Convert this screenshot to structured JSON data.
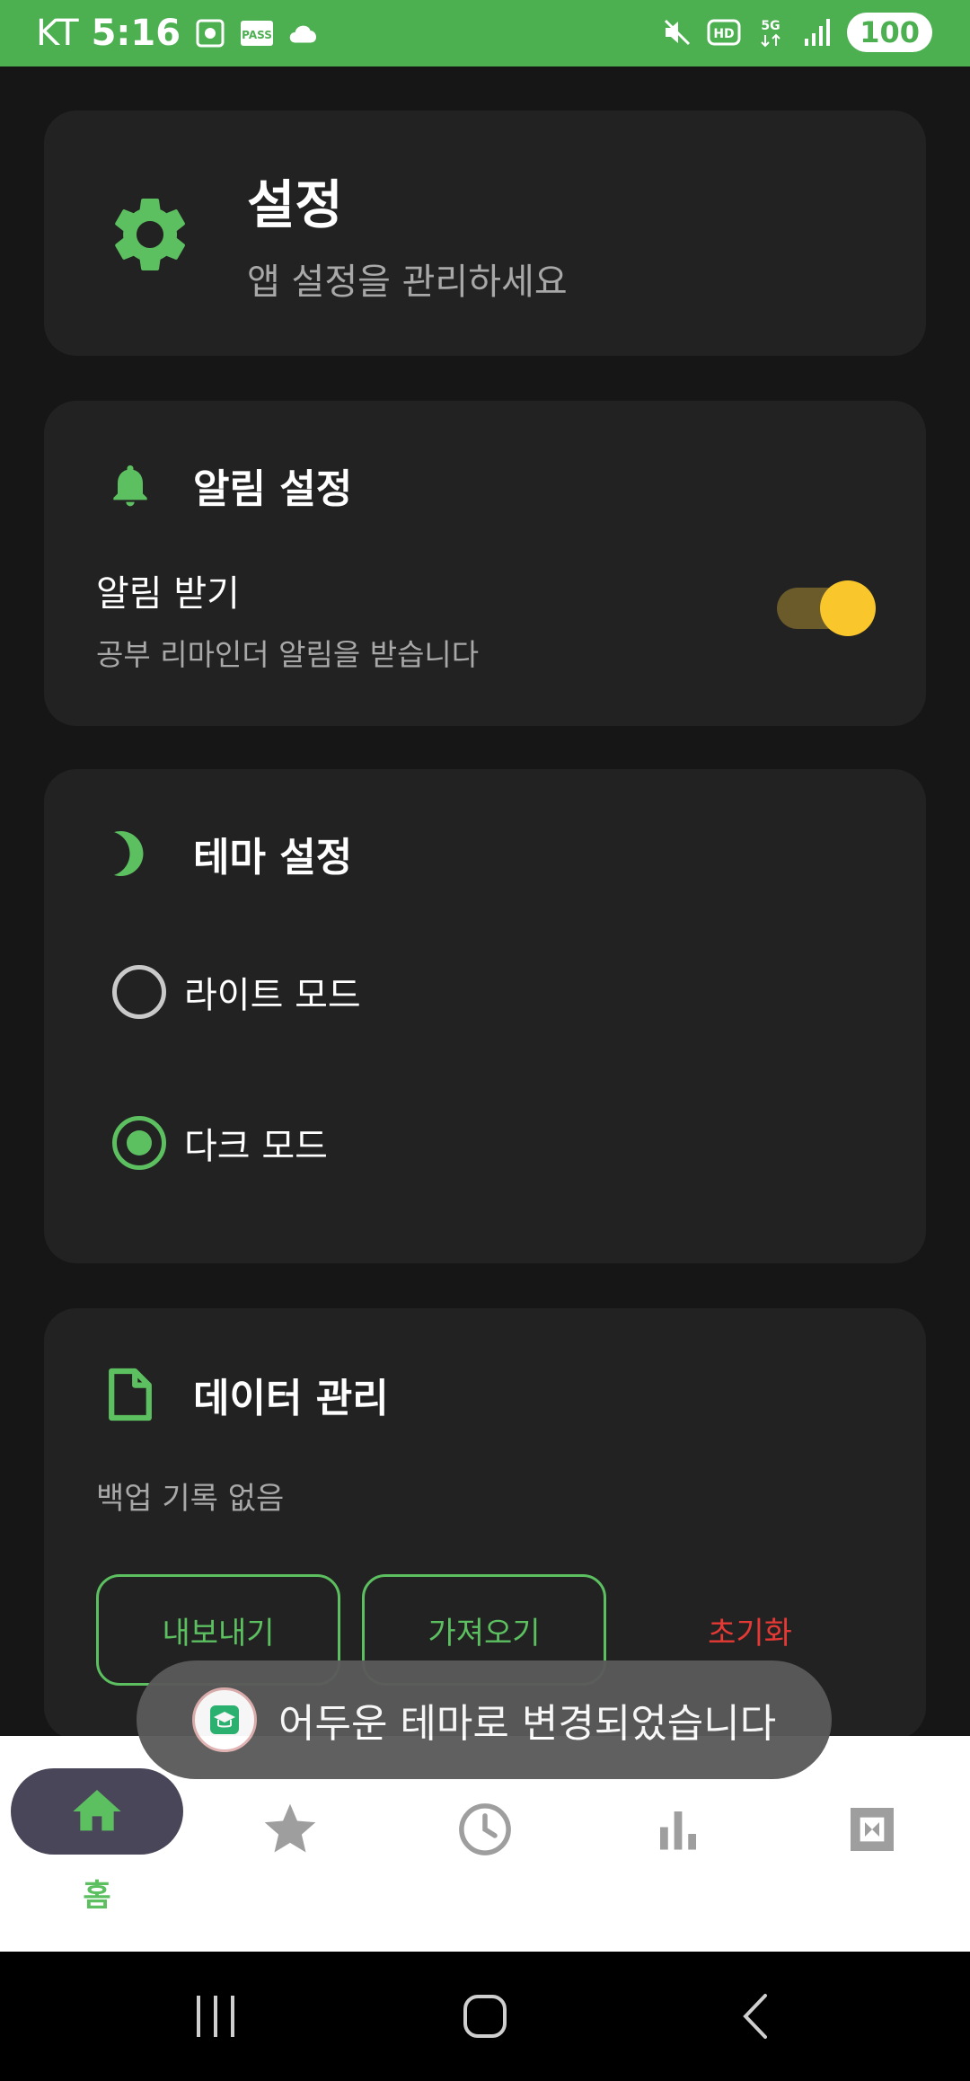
{
  "statusbar": {
    "carrier": "KT",
    "time": "5:16",
    "battery": "100",
    "icons": [
      "screenshot-icon",
      "pass-icon",
      "cloud-icon",
      "mute-icon",
      "hd-icon",
      "5g-icon",
      "signal-icon"
    ]
  },
  "header": {
    "title": "설정",
    "subtitle": "앱 설정을 관리하세요",
    "icon": "gear-icon"
  },
  "notification": {
    "title": "알림 설정",
    "icon": "bell-icon",
    "option_label": "알림 받기",
    "option_desc": "공부 리마인더 알림을 받습니다",
    "enabled": true
  },
  "theme": {
    "title": "테마 설정",
    "icon": "moon-icon",
    "options": [
      {
        "label": "라이트 모드",
        "selected": false
      },
      {
        "label": "다크 모드",
        "selected": true
      }
    ]
  },
  "data": {
    "title": "데이터 관리",
    "icon": "document-icon",
    "backup_status": "백업 기록 없음",
    "export_label": "내보내기",
    "import_label": "가져오기",
    "reset_label": "초기화"
  },
  "toast": {
    "message": "어두운 테마로 변경되었습니다"
  },
  "bottomnav": {
    "items": [
      {
        "icon": "home-icon",
        "label": "홈",
        "active": true
      },
      {
        "icon": "star-icon",
        "label": "",
        "active": false
      },
      {
        "icon": "clock-icon",
        "label": "",
        "active": false
      },
      {
        "icon": "bar-chart-icon",
        "label": "",
        "active": false
      },
      {
        "icon": "settings-icon",
        "label": "",
        "active": false
      }
    ]
  },
  "colors": {
    "accent": "#5CBF60",
    "statusbar": "#4CAF50",
    "background": "#161616",
    "card": "#222222",
    "toggle_knob": "#F9C62B",
    "danger": "#E53935"
  }
}
